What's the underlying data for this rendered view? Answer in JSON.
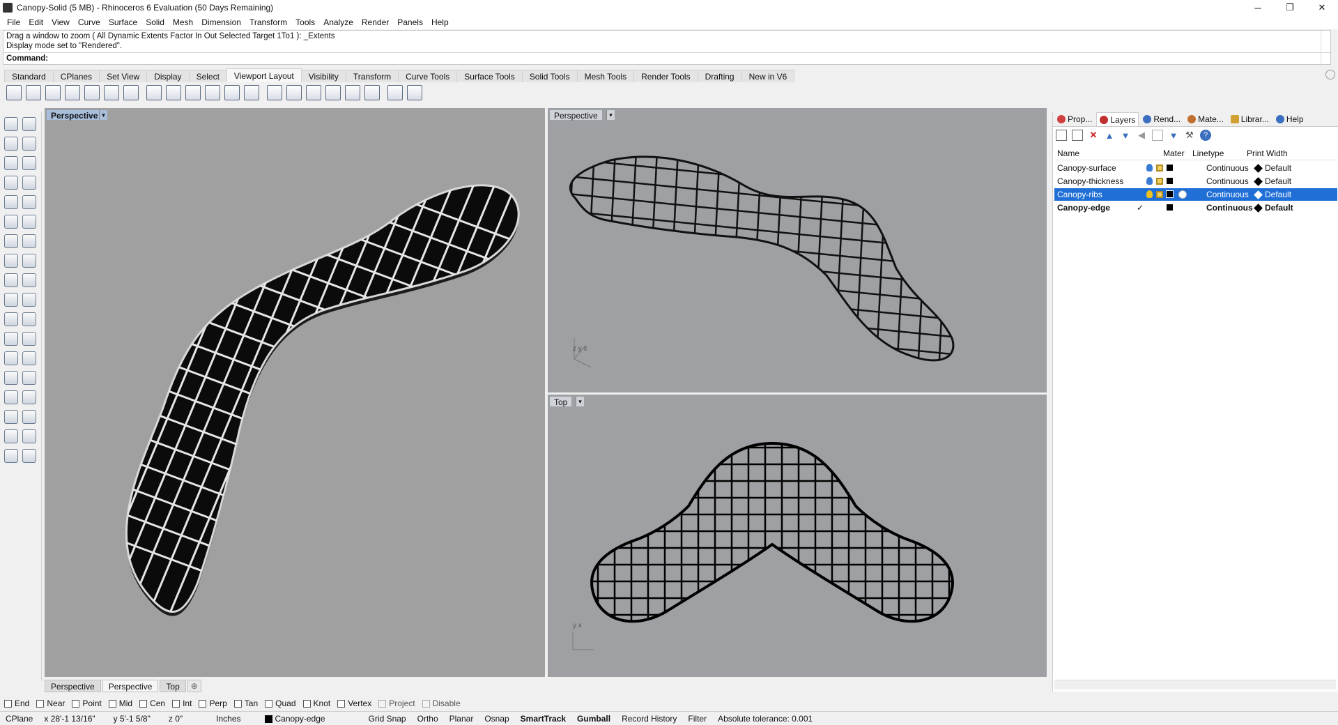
{
  "window": {
    "title": "Canopy-Solid (5 MB) - Rhinoceros 6 Evaluation (50 Days Remaining)",
    "minimize": "─",
    "restore": "❐",
    "close": "✕"
  },
  "menu": [
    "File",
    "Edit",
    "View",
    "Curve",
    "Surface",
    "Solid",
    "Mesh",
    "Dimension",
    "Transform",
    "Tools",
    "Analyze",
    "Render",
    "Panels",
    "Help"
  ],
  "command": {
    "history_line1": "Drag a window to zoom ( All  Dynamic  Extents  Factor  In  Out  Selected  Target  1To1 ): _Extents",
    "history_line2": "Display mode set to \"Rendered\".",
    "prompt": "Command:"
  },
  "toolbar_tabs": [
    "Standard",
    "CPlanes",
    "Set View",
    "Display",
    "Select",
    "Viewport Layout",
    "Visibility",
    "Transform",
    "Curve Tools",
    "Surface Tools",
    "Solid Tools",
    "Mesh Tools",
    "Render Tools",
    "Drafting",
    "New in V6"
  ],
  "active_toolbar_tab": "Viewport Layout",
  "viewports": {
    "vp1": {
      "label": "Perspective",
      "active": true
    },
    "vp2": {
      "label": "Perspective",
      "axis": "z y x"
    },
    "vp3": {
      "label": "Top",
      "axis": "y x"
    }
  },
  "viewport_tabs": [
    "Perspective",
    "Perspective",
    "Top"
  ],
  "viewport_tab_add": "⊕",
  "osnaps": [
    {
      "label": "End",
      "enabled": true
    },
    {
      "label": "Near",
      "enabled": true
    },
    {
      "label": "Point",
      "enabled": true
    },
    {
      "label": "Mid",
      "enabled": true
    },
    {
      "label": "Cen",
      "enabled": true
    },
    {
      "label": "Int",
      "enabled": true
    },
    {
      "label": "Perp",
      "enabled": true
    },
    {
      "label": "Tan",
      "enabled": true
    },
    {
      "label": "Quad",
      "enabled": true
    },
    {
      "label": "Knot",
      "enabled": true
    },
    {
      "label": "Vertex",
      "enabled": true
    },
    {
      "label": "Project",
      "enabled": false
    },
    {
      "label": "Disable",
      "enabled": false
    }
  ],
  "status": {
    "cplane": "CPlane",
    "x": "x 28'-1 13/16\"",
    "y": "y 5'-1 5/8\"",
    "z": "z 0\"",
    "units": "Inches",
    "layer": "Canopy-edge",
    "grid_snap": "Grid Snap",
    "ortho": "Ortho",
    "planar": "Planar",
    "osnap": "Osnap",
    "smarttrack": "SmartTrack",
    "gumball": "Gumball",
    "record_history": "Record History",
    "filter": "Filter",
    "tolerance": "Absolute tolerance: 0.001"
  },
  "panel": {
    "tabs": [
      {
        "label": "Prop...",
        "icon": "properties-icon",
        "color": "#d04040"
      },
      {
        "label": "Layers",
        "icon": "layers-icon",
        "color": "#c03030"
      },
      {
        "label": "Rend...",
        "icon": "render-icon",
        "color": "#3a6fc0"
      },
      {
        "label": "Mate...",
        "icon": "material-icon",
        "color": "#c07030"
      },
      {
        "label": "Librar...",
        "icon": "folder-icon",
        "color": "#d0a030"
      },
      {
        "label": "Help",
        "icon": "help-icon",
        "color": "#3a6fc0"
      }
    ],
    "active_tab": "Layers",
    "headers": {
      "name": "Name",
      "material": "Mater",
      "linetype": "Linetype",
      "print_width": "Print Width"
    },
    "layers": [
      {
        "name": "Canopy-surface",
        "linetype": "Continuous",
        "print_width": "Default",
        "selected": false,
        "current": false
      },
      {
        "name": "Canopy-thickness",
        "linetype": "Continuous",
        "print_width": "Default",
        "selected": false,
        "current": false
      },
      {
        "name": "Canopy-ribs",
        "linetype": "Continuous",
        "print_width": "Default",
        "selected": true,
        "current": false
      },
      {
        "name": "Canopy-edge",
        "linetype": "Continuous",
        "print_width": "Default",
        "selected": false,
        "current": true
      }
    ],
    "current_mark": "✓"
  }
}
